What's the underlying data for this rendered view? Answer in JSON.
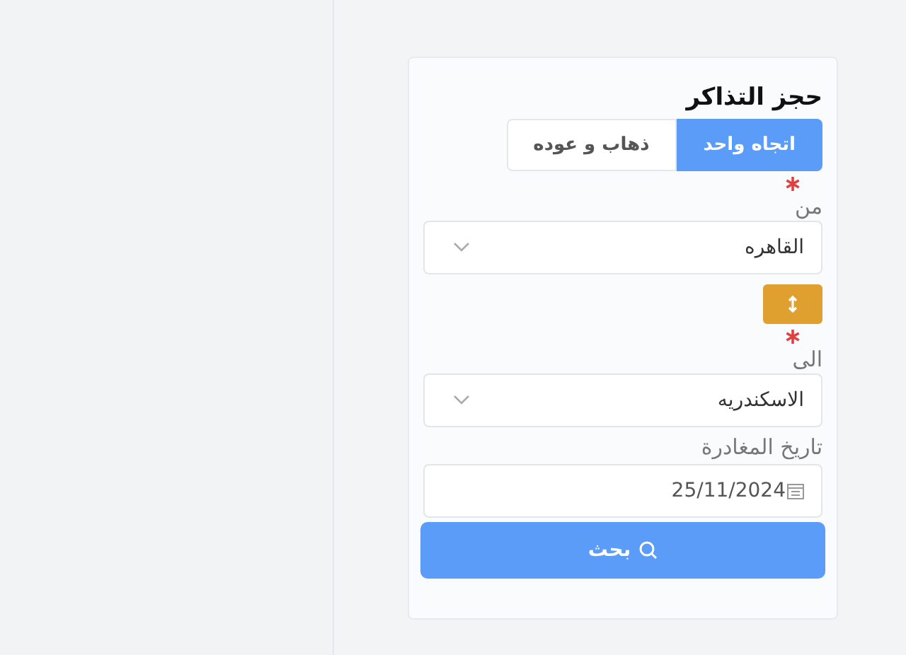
{
  "title": "حجز التذاكر",
  "trip_types": [
    {
      "label": "اتجاه واحد",
      "selected": true
    },
    {
      "label": "ذهاب و عوده",
      "selected": false
    }
  ],
  "from_field": {
    "label": "من",
    "required": true,
    "value": "القاهره"
  },
  "to_field": {
    "label": "الى",
    "required": true,
    "value": "الاسكندريه"
  },
  "date_field": {
    "label": "تاريخ المغادرة",
    "value": "25/11/2024"
  },
  "search_button": {
    "label": "بحث"
  }
}
